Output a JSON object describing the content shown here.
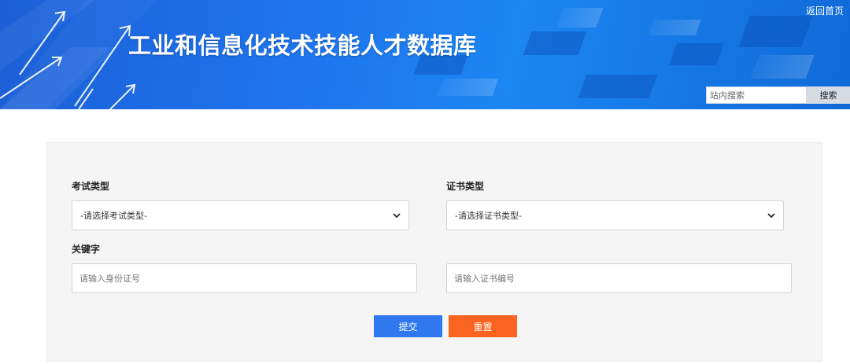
{
  "header": {
    "site_title": "工业和信息化技术技能人才数据库",
    "home_link": "返回首页",
    "search": {
      "placeholder": "站内搜索",
      "button_label": "搜索"
    }
  },
  "form": {
    "exam_type": {
      "label": "考试类型",
      "selected": "-请选择考试类型-"
    },
    "cert_type": {
      "label": "证书类型",
      "selected": "-请选择证书类型-"
    },
    "keyword": {
      "label": "关键字",
      "id_placeholder": "请输入身份证号",
      "cert_no_placeholder": "请输入证书编号"
    },
    "submit_label": "提交",
    "reset_label": "重置"
  },
  "colors": {
    "banner": "#1f74ee",
    "submit": "#2f78f0",
    "reset": "#fb6321",
    "panel": "#f5f5f5"
  }
}
